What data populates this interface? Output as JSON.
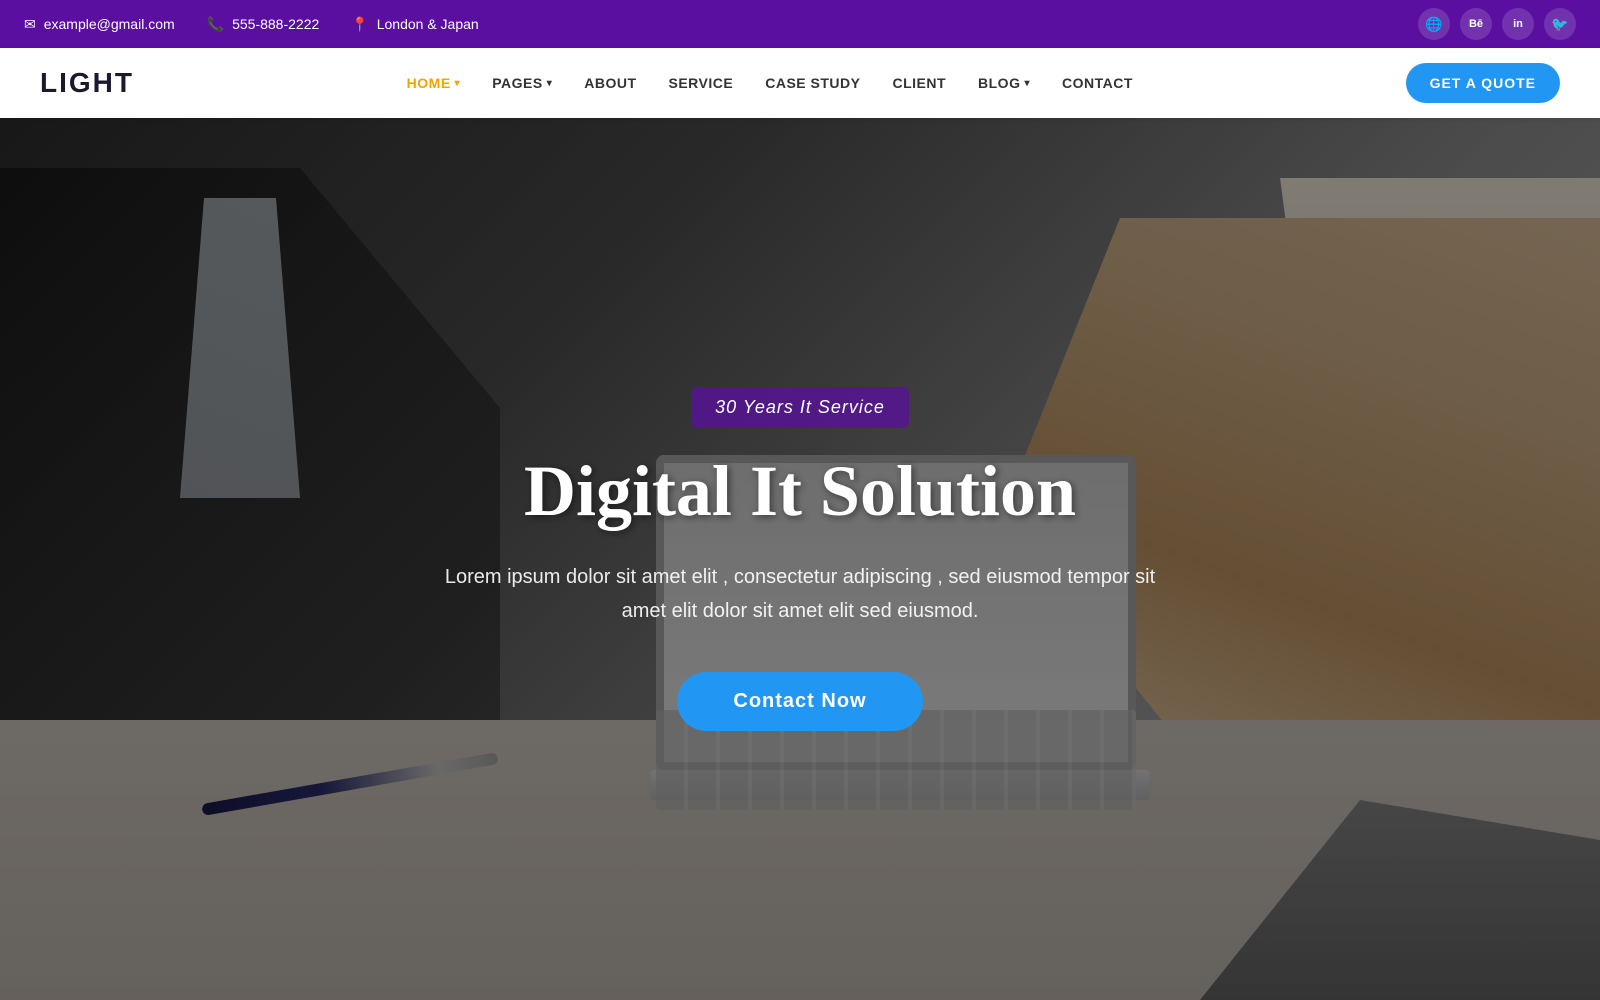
{
  "topbar": {
    "email": "example@gmail.com",
    "phone": "555-888-2222",
    "location": "London & Japan",
    "socials": [
      {
        "name": "globe-icon",
        "symbol": "🌐"
      },
      {
        "name": "behance-icon",
        "symbol": "Bē"
      },
      {
        "name": "linkedin-icon",
        "symbol": "in"
      },
      {
        "name": "twitter-icon",
        "symbol": "🐦"
      }
    ]
  },
  "navbar": {
    "logo": "LIGHT",
    "links": [
      {
        "label": "HOME",
        "active": true,
        "dropdown": true
      },
      {
        "label": "PAGES",
        "active": false,
        "dropdown": true
      },
      {
        "label": "ABOUT",
        "active": false,
        "dropdown": false
      },
      {
        "label": "SERVICE",
        "active": false,
        "dropdown": false
      },
      {
        "label": "CASE STUDY",
        "active": false,
        "dropdown": false
      },
      {
        "label": "CLIENT",
        "active": false,
        "dropdown": false
      },
      {
        "label": "BLOG",
        "active": false,
        "dropdown": true
      },
      {
        "label": "CONTACT",
        "active": false,
        "dropdown": false
      }
    ],
    "cta_label": "GET A QUOTE"
  },
  "hero": {
    "badge": "30 Years It Service",
    "title": "Digital It Solution",
    "subtitle": "Lorem ipsum dolor sit amet elit , consectetur adipiscing , sed eiusmod tempor sit amet elit dolor sit amet elit sed eiusmod.",
    "cta_label": "Contact Now"
  }
}
